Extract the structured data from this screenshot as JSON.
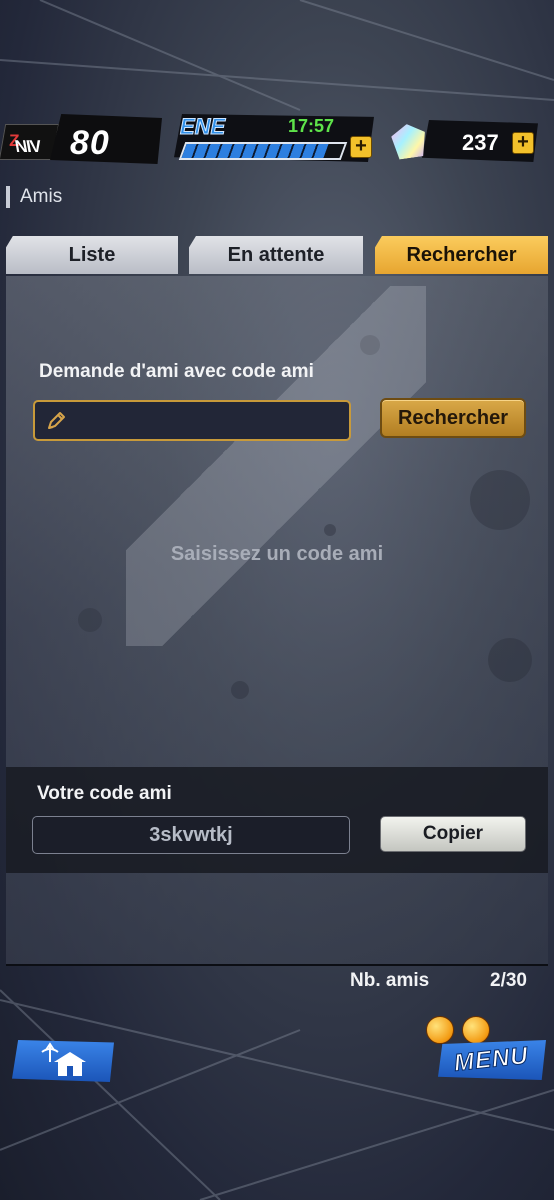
{
  "hud": {
    "level_tag": "NIV",
    "level_tag_suffix": "Z",
    "level": "80",
    "energy_label": "ENE",
    "energy_timer": "17:57",
    "energy_level": 0.9,
    "gems": "237",
    "plus": "+"
  },
  "page": {
    "title": "Amis"
  },
  "tabs": [
    {
      "label": "Liste",
      "active": false
    },
    {
      "label": "En attente",
      "active": false
    },
    {
      "label": "Rechercher",
      "active": true
    }
  ],
  "search": {
    "section_label": "Demande d'ami avec code ami",
    "input_value": "",
    "button_label": "Rechercher",
    "empty_hint": "Saisissez un code ami"
  },
  "your_code": {
    "label": "Votre code ami",
    "value": "3skvwtkj",
    "copy_label": "Copier"
  },
  "friends": {
    "label": "Nb. amis",
    "count": "2/30"
  },
  "bottom": {
    "menu_label": "MENU",
    "home_icon": "home-icon"
  },
  "colors": {
    "tab_active": "#e7a530",
    "accent_gold": "#c89a3a",
    "energy_blue": "#2d7fe0",
    "timer_green": "#5ee34a"
  }
}
